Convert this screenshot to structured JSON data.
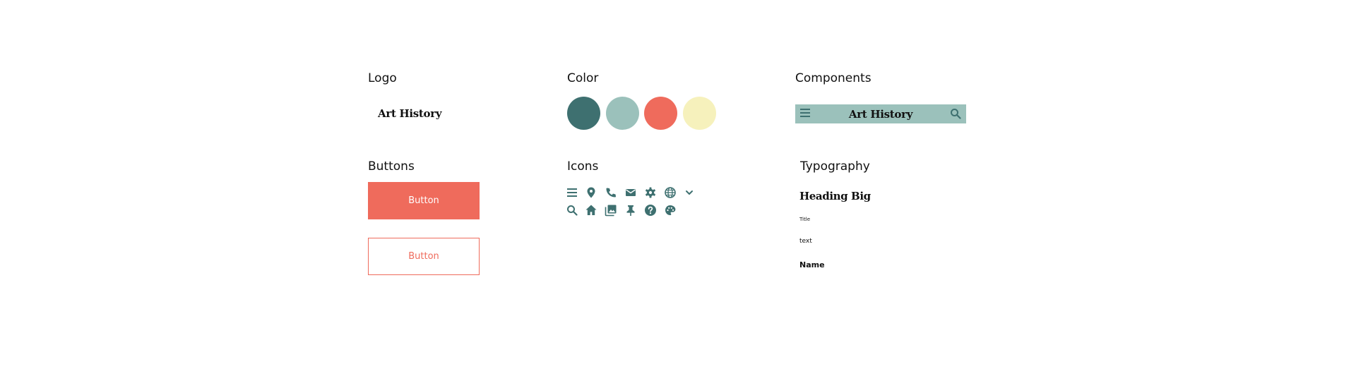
{
  "sections": {
    "logo": "Logo",
    "color": "Color",
    "components": "Components",
    "buttons": "Buttons",
    "icons": "Icons",
    "typography": "Typography"
  },
  "logo": {
    "text": "Art History"
  },
  "colors": [
    "#3e7070",
    "#9bc1bb",
    "#ef6b5c",
    "#f6f1bc"
  ],
  "component_nav": {
    "brand": "Art History",
    "left_icon": "menu-icon",
    "right_icon": "search-icon",
    "background": "#9bc1bb"
  },
  "buttons": {
    "primary_label": "Button",
    "secondary_label": "Button",
    "accent": "#ef6b5c"
  },
  "icons": {
    "row1": [
      "menu-icon",
      "location-pin-icon",
      "phone-icon",
      "mail-icon",
      "gear-icon",
      "globe-icon",
      "chevron-down-icon"
    ],
    "row2": [
      "search-icon",
      "home-icon",
      "photos-icon",
      "pushpin-icon",
      "help-icon",
      "palette-icon"
    ],
    "color": "#3e7070"
  },
  "typography": {
    "heading": "Heading Big",
    "title": "Title",
    "text": "text",
    "name": "Name"
  }
}
